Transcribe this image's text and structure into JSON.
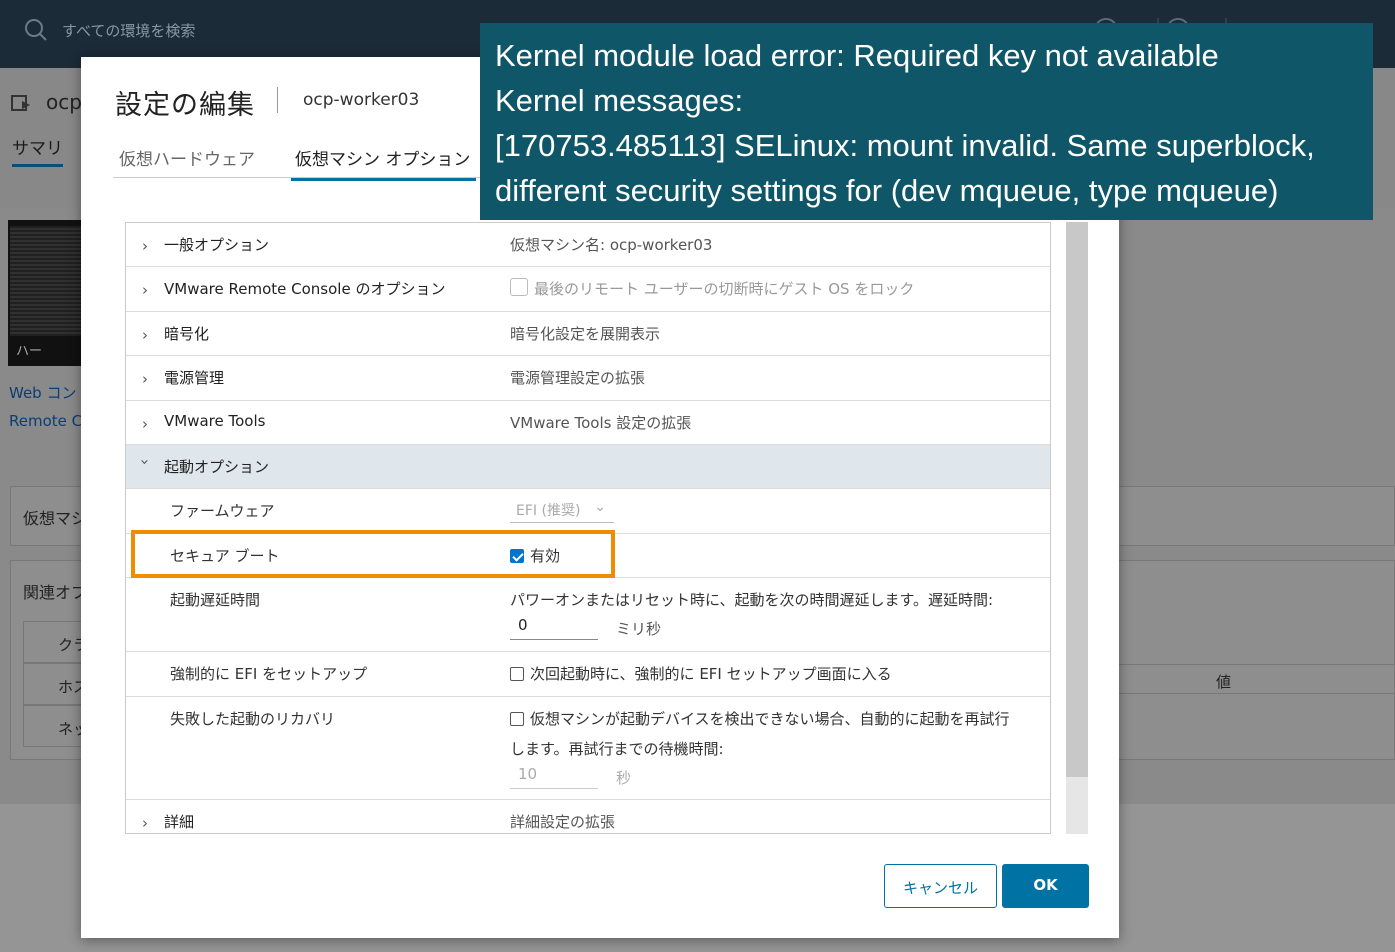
{
  "topbar": {
    "search_placeholder": "すべての環境を検索"
  },
  "background": {
    "title": "ocp",
    "summary_tab": "サマリ",
    "console_caption": "ハー",
    "link_web_console": "Web コン",
    "link_remote_console": "Remote C",
    "card_vm_label": "仮想マシ",
    "card_related_label": "関連オブ",
    "related_rows": [
      "クラ",
      "ホス",
      "ネッ"
    ],
    "table_value_header": "値"
  },
  "modal": {
    "title": "設定の編集",
    "subtitle": "ocp-worker03",
    "tabs": [
      {
        "label": "仮想ハードウェア",
        "active": false
      },
      {
        "label": "仮想マシン オプション",
        "active": true
      }
    ],
    "rows": {
      "general": {
        "label": "一般オプション",
        "value": "仮想マシン名: ocp-worker03"
      },
      "vmrc": {
        "label": "VMware Remote Console のオプション",
        "value": "最後のリモート ユーザーの切断時にゲスト OS をロック",
        "checked": false
      },
      "encryption": {
        "label": "暗号化",
        "value": "暗号化設定を展開表示"
      },
      "power": {
        "label": "電源管理",
        "value": "電源管理設定の拡張"
      },
      "tools": {
        "label": "VMware Tools",
        "value": "VMware Tools 設定の拡張"
      },
      "boot": {
        "label": "起動オプション"
      },
      "firmware": {
        "label": "ファームウェア",
        "value": "EFI (推奨)"
      },
      "secure_boot": {
        "label": "セキュア ブート",
        "value": "有効",
        "checked": true
      },
      "boot_delay": {
        "label": "起動遅延時間",
        "description": "パワーオンまたはリセット時に、起動を次の時間遅延します。遅延時間:",
        "value": "0",
        "unit": "ミリ秒"
      },
      "force_efi": {
        "label": "強制的に EFI をセットアップ",
        "value": "次回起動時に、強制的に EFI セットアップ画面に入る",
        "checked": false
      },
      "failed_boot": {
        "label": "失敗した起動のリカバリ",
        "description_line1": "仮想マシンが起動デバイスを検出できない場合、自動的に起動を再試行",
        "description_line2": "します。再試行までの待機時間:",
        "value": "10",
        "unit": "秒",
        "checked": false
      },
      "advanced": {
        "label": "詳細",
        "value": "詳細設定の拡張"
      }
    },
    "cancel_label": "キャンセル",
    "ok_label": "OK"
  },
  "overlay": {
    "lines": [
      "Kernel module load error: Required key not available",
      "Kernel messages:",
      "[170753.485113] SELinux: mount invalid.  Same superblock,",
      "different security settings for (dev mqueue, type mqueue)"
    ]
  },
  "colors": {
    "accent": "#0072a3",
    "highlight": "#f08c00",
    "overlay_bg": "#0f5668",
    "topbar": "#1c2b38"
  }
}
